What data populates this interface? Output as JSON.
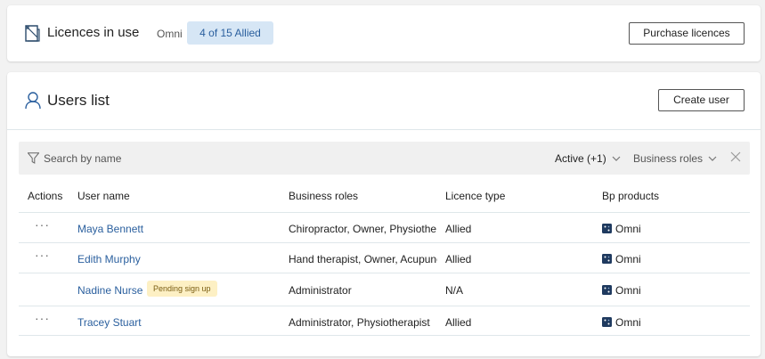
{
  "licences": {
    "title": "Licences in use",
    "product": "Omni",
    "badge": "4 of 15 Allied",
    "purchase_label": "Purchase licences"
  },
  "users": {
    "title": "Users list",
    "create_label": "Create user",
    "search_placeholder": "Search by name",
    "filter_active": "Active (+1)",
    "filter_roles": "Business roles",
    "columns": {
      "actions": "Actions",
      "name": "User name",
      "roles": "Business roles",
      "licence": "Licence type",
      "bp": "Bp products"
    },
    "rows": [
      {
        "actions": "···",
        "name": "Maya Bennett",
        "roles": "Chiropractor, Owner, Physiothe",
        "licence": "Allied",
        "bp": "Omni",
        "badge": ""
      },
      {
        "actions": "···",
        "name": "Edith Murphy",
        "roles": "Hand therapist, Owner, Acupunc",
        "licence": "Allied",
        "bp": "Omni",
        "badge": ""
      },
      {
        "actions": "",
        "name": "Nadine Nurse",
        "roles": "Administrator",
        "licence": "N/A",
        "bp": "Omni",
        "badge": "Pending sign up"
      },
      {
        "actions": "···",
        "name": "Tracey Stuart",
        "roles": "Administrator, Physiotherapist",
        "licence": "Allied",
        "bp": "Omni",
        "badge": ""
      }
    ]
  },
  "colors": {
    "accent": "#2a5f9e",
    "badge_bg": "#d6e6f5",
    "pending_bg": "#fdf0c4",
    "bp_icon": "#1f3a5f"
  },
  "icons": {
    "licences": "licence-document-icon",
    "users": "user-icon",
    "filter": "filter-icon",
    "clear": "close-icon",
    "bp": "omni-product-icon"
  }
}
